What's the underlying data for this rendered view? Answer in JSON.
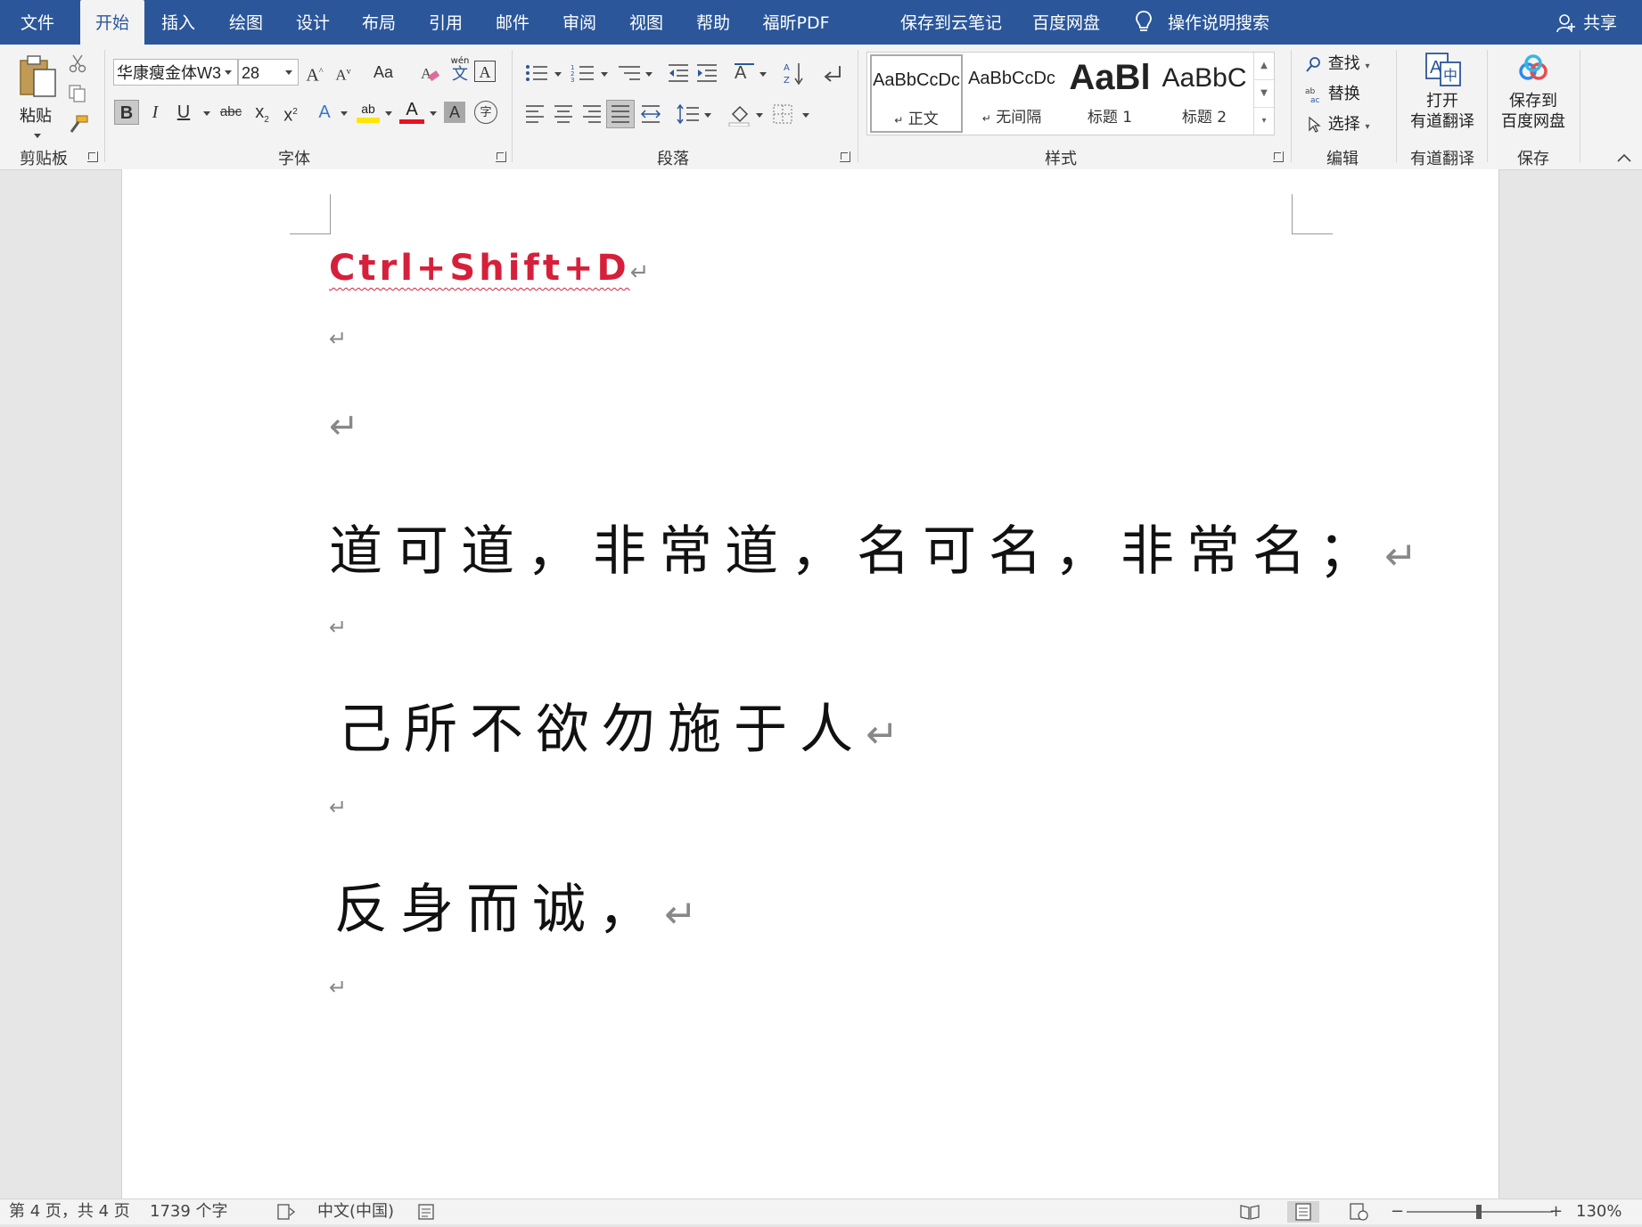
{
  "menubar": {
    "tabs": [
      "文件",
      "开始",
      "插入",
      "绘图",
      "设计",
      "布局",
      "引用",
      "邮件",
      "审阅",
      "视图",
      "帮助",
      "福昕PDF"
    ],
    "active_tab": "开始",
    "save_to_cloud_note": "保存到云笔记",
    "baidu_netdisk": "百度网盘",
    "search_help": "操作说明搜索",
    "share": "共享"
  },
  "ribbon": {
    "clipboard": {
      "paste": "粘贴",
      "label": "剪贴板"
    },
    "font": {
      "font_name": "华康瘦金体W3",
      "font_size": "28",
      "grow_glyph": "A",
      "shrink_glyph": "A",
      "case_glyph": "Aa",
      "phonetic_glyph": "wén",
      "phonetic_char": "文",
      "border_glyph": "A",
      "bold": "B",
      "italic": "I",
      "underline": "U",
      "strike": "abc",
      "subscript": "x",
      "superscript": "x",
      "sub_mark": "2",
      "sup_mark": "2",
      "effect_glyph": "A",
      "highlight_glyph": "ab",
      "color_glyph": "A",
      "shading_glyph": "A",
      "enclose_glyph": "字",
      "highlight_color": "#ffe600",
      "font_color": "#e81123",
      "label": "字体"
    },
    "paragraph": {
      "label": "段落"
    },
    "styles": {
      "items": [
        {
          "preview": "AaBbCcDc",
          "name": "正文",
          "mark": "↵"
        },
        {
          "preview": "AaBbCcDc",
          "name": "无间隔",
          "mark": "↵"
        },
        {
          "preview": "AaBl",
          "name": "标题 1"
        },
        {
          "preview": "AaBbC",
          "name": "标题 2"
        }
      ],
      "label": "样式"
    },
    "editing": {
      "find": "查找",
      "replace": "替换",
      "select": "选择",
      "label": "编辑"
    },
    "youdao": {
      "line1": "打开",
      "line2": "有道翻译",
      "label": "有道翻译"
    },
    "baidu": {
      "line1": "保存到",
      "line2": "百度网盘",
      "label": "保存"
    }
  },
  "document": {
    "heading": "Ctrl+Shift+D",
    "line1": "道可道，非常道，名可名，非常名；",
    "line2": "己所不欲勿施于人",
    "line3": "反身而诚，",
    "para_mark": "↵"
  },
  "statusbar": {
    "page": "第 4 页，共 4 页",
    "words": "1739 个字",
    "language": "中文(中国)",
    "zoom": "130%",
    "zoom_minus": "−",
    "zoom_plus": "+"
  },
  "colors": {
    "title_bar": "#2b579a",
    "ribbon": "#f3f3f3",
    "heading_red": "#d6203b"
  }
}
